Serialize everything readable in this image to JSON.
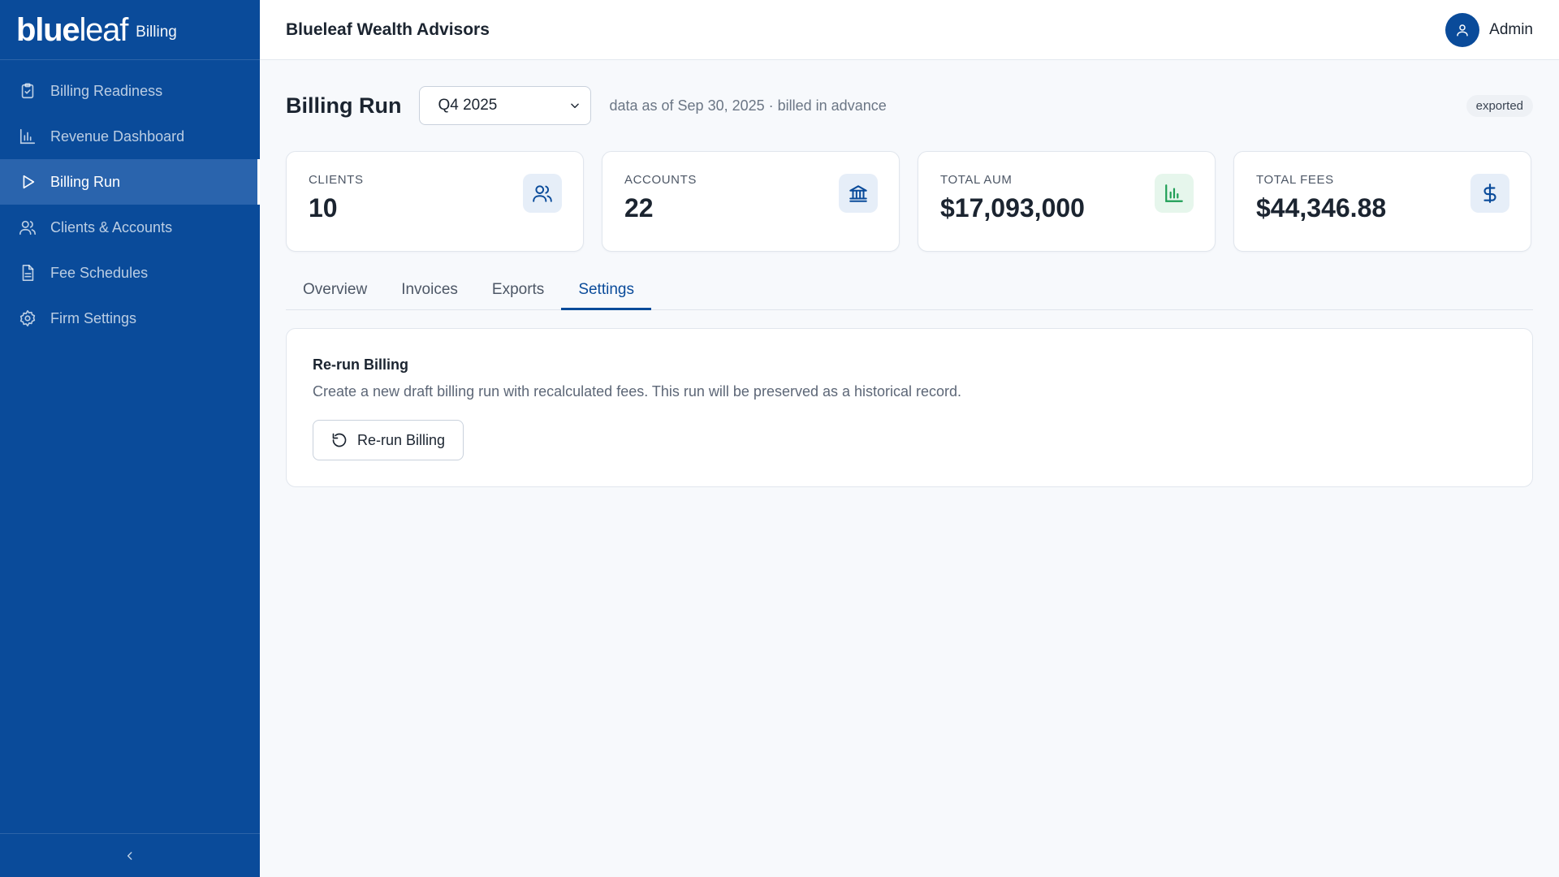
{
  "brand": {
    "logo_bold": "blue",
    "logo_light": "leaf",
    "product": "Billing"
  },
  "sidebar": {
    "items": [
      {
        "label": "Billing Readiness",
        "icon": "clipboard-check-icon",
        "active": false
      },
      {
        "label": "Revenue Dashboard",
        "icon": "bar-chart-icon",
        "active": false
      },
      {
        "label": "Billing Run",
        "icon": "play-icon",
        "active": true
      },
      {
        "label": "Clients & Accounts",
        "icon": "users-icon",
        "active": false
      },
      {
        "label": "Fee Schedules",
        "icon": "document-icon",
        "active": false
      },
      {
        "label": "Firm Settings",
        "icon": "gear-icon",
        "active": false
      }
    ],
    "collapse_icon": "chevron-left-icon"
  },
  "header": {
    "firm_name": "Blueleaf Wealth Advisors",
    "user_name": "Admin",
    "user_icon": "user-icon"
  },
  "page": {
    "title": "Billing Run",
    "period_selected": "Q4 2025",
    "meta": "data as of Sep 30, 2025 · billed in advance",
    "status": "exported"
  },
  "stats": [
    {
      "label": "CLIENTS",
      "value": "10",
      "icon": "users-icon"
    },
    {
      "label": "ACCOUNTS",
      "value": "22",
      "icon": "bank-icon"
    },
    {
      "label": "TOTAL AUM",
      "value": "$17,093,000",
      "icon": "bar-chart-icon"
    },
    {
      "label": "TOTAL FEES",
      "value": "$44,346.88",
      "icon": "dollar-icon"
    }
  ],
  "tabs": [
    {
      "label": "Overview",
      "active": false
    },
    {
      "label": "Invoices",
      "active": false
    },
    {
      "label": "Exports",
      "active": false
    },
    {
      "label": "Settings",
      "active": true
    }
  ],
  "settings_panel": {
    "title": "Re-run Billing",
    "description": "Create a new draft billing run with recalculated fees. This run will be preserved as a historical record.",
    "button_label": "Re-run Billing",
    "button_icon": "refresh-icon"
  },
  "colors": {
    "sidebar": "#0a4b9a",
    "sidebar_active": "#2a64ad",
    "accent": "#0a4b9a",
    "aum_icon": "#1e9e55",
    "background": "#f7f9fc"
  }
}
